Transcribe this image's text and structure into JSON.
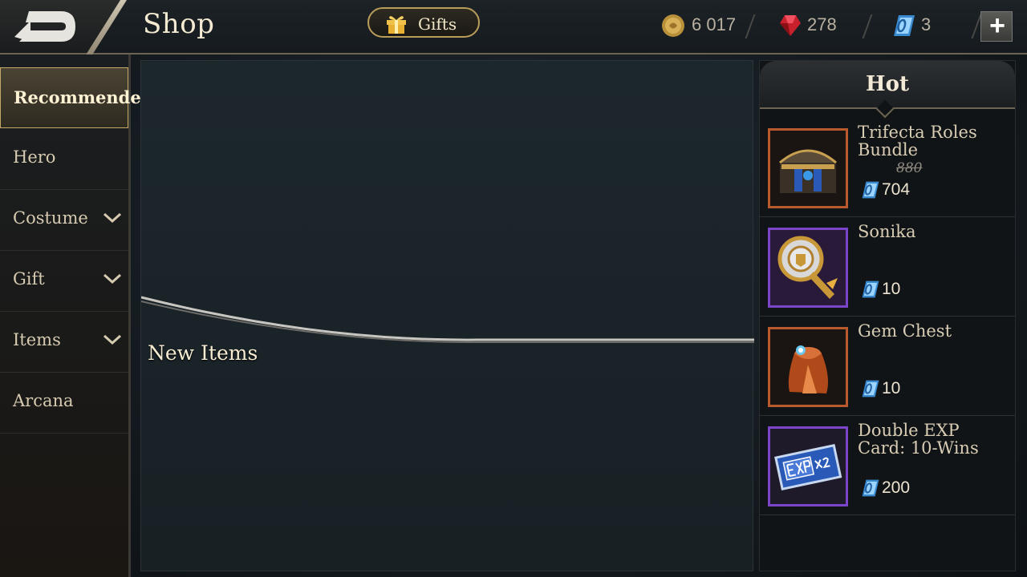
{
  "header": {
    "title": "Shop",
    "gifts_label": "Gifts",
    "currencies": [
      {
        "name": "gold",
        "value": "6 017",
        "color": "#c9a045"
      },
      {
        "name": "ruby",
        "value": "278",
        "color": "#d83040"
      },
      {
        "name": "voucher",
        "value": "3",
        "color": "#4aa8e8"
      }
    ]
  },
  "sidebar": {
    "items": [
      {
        "label": "Recommended",
        "active": true,
        "expandable": false
      },
      {
        "label": "Hero",
        "active": false,
        "expandable": false
      },
      {
        "label": "Costume",
        "active": false,
        "expandable": true
      },
      {
        "label": "Gift",
        "active": false,
        "expandable": true
      },
      {
        "label": "Items",
        "active": false,
        "expandable": true
      },
      {
        "label": "Arcana",
        "active": false,
        "expandable": false
      }
    ]
  },
  "main": {
    "section_title": "New Items"
  },
  "hot": {
    "title": "Hot",
    "items": [
      {
        "name": "Trifecta Roles Bundle",
        "old_price": "880",
        "price": "704",
        "icon": "treasure-chest-icon",
        "rarity_color": "#b85a2e"
      },
      {
        "name": "Sonika",
        "old_price": "",
        "price": "10",
        "icon": "golden-hammer-icon",
        "rarity_color": "#7c44c8"
      },
      {
        "name": "Gem Chest",
        "old_price": "",
        "price": "10",
        "icon": "gem-pouch-icon",
        "rarity_color": "#b85a2e"
      },
      {
        "name": "Double EXP Card: 10-Wins",
        "old_price": "",
        "price": "200",
        "icon": "exp-card-icon",
        "rarity_color": "#7c44c8"
      }
    ]
  }
}
